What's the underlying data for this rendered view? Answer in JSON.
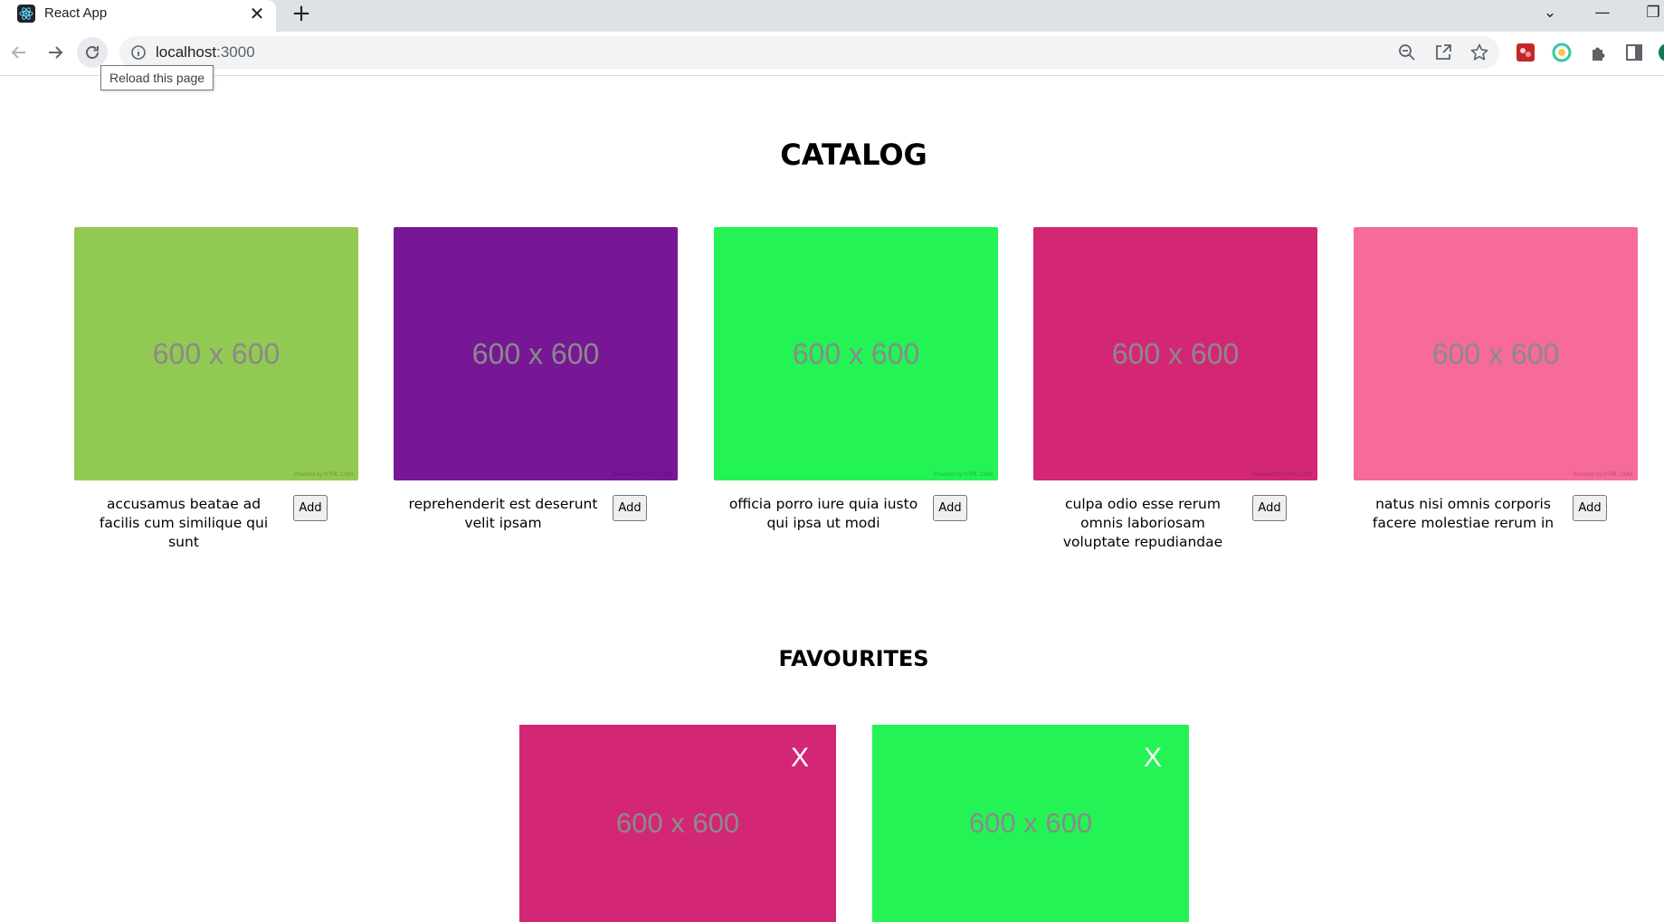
{
  "browser": {
    "tab_title": "React App",
    "tab_close": "✕",
    "new_tab": "+",
    "url_host": "localhost",
    "url_port": ":3000",
    "tooltip": "Reload this page",
    "win_chevron": "⌄",
    "win_minimize": "—",
    "win_restore": "❐"
  },
  "catalog": {
    "heading": "CATALOG",
    "add_label": "Add",
    "items": [
      {
        "title": "accusamus beatae ad facilis cum similique qui sunt",
        "color": "#92c952",
        "placeholder": "600 x 600",
        "powered": "Powered by HTML.COM"
      },
      {
        "title": "reprehenderit est deserunt velit ipsam",
        "color": "#771796",
        "placeholder": "600 x 600",
        "powered": "Powered by HTML.COM"
      },
      {
        "title": "officia porro iure quia iusto qui ipsa ut modi",
        "color": "#24f355",
        "placeholder": "600 x 600",
        "powered": "Powered by HTML.COM"
      },
      {
        "title": "culpa odio esse rerum omnis laboriosam voluptate repudiandae",
        "color": "#d32776",
        "placeholder": "600 x 600",
        "powered": "Powered by HTML.COM"
      },
      {
        "title": "natus nisi omnis corporis facere molestiae rerum in",
        "color": "#f66b97",
        "placeholder": "600 x 600",
        "powered": "Powered by HTML.COM"
      }
    ]
  },
  "favourites": {
    "heading": "FAVOURITES",
    "remove_label": "X",
    "items": [
      {
        "color": "#d32776",
        "placeholder": "600 x 600"
      },
      {
        "color": "#24f355",
        "placeholder": "600 x 600"
      }
    ]
  }
}
